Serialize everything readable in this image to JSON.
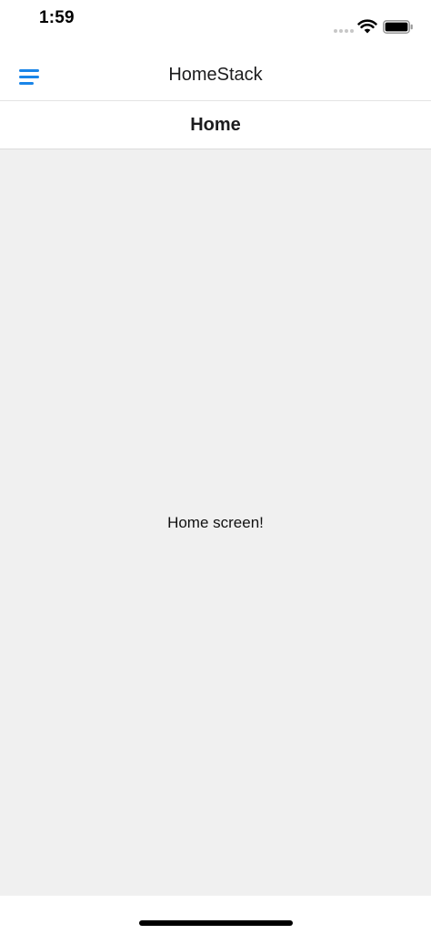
{
  "status_bar": {
    "time": "1:59",
    "icons": [
      "signal-dots-icon",
      "wifi-icon",
      "battery-icon"
    ]
  },
  "drawer_header": {
    "title": "HomeStack",
    "menu_icon": "hamburger-menu-icon",
    "accent_color": "#1a85e8"
  },
  "stack_header": {
    "title": "Home"
  },
  "content": {
    "text": "Home screen!",
    "background_color": "#f0f0f0"
  }
}
